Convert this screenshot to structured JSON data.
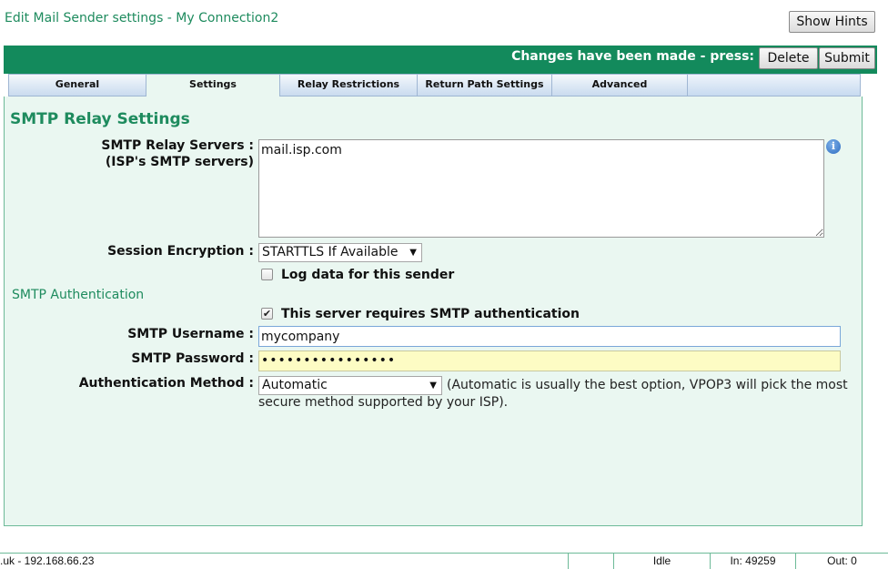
{
  "page": {
    "title": "Edit Mail Sender settings - My Connection2",
    "show_hints_label": "Show Hints"
  },
  "toolbar": {
    "changes_text": "Changes have been made - press:",
    "delete_label": "Delete",
    "submit_label": "Submit"
  },
  "tabs": [
    {
      "label": "General",
      "active": false
    },
    {
      "label": "Settings",
      "active": true
    },
    {
      "label": "Relay Restrictions",
      "active": false
    },
    {
      "label": "Return Path Settings",
      "active": false
    },
    {
      "label": "Advanced",
      "active": false
    }
  ],
  "settings": {
    "section_title": "SMTP Relay Settings",
    "relay_servers_label_1": "SMTP Relay Servers :",
    "relay_servers_label_2": "(ISP's SMTP servers)",
    "relay_servers_value": "mail.isp.com",
    "info_icon_glyph": "i",
    "encryption_label": "Session Encryption :",
    "encryption_value": "STARTTLS If Available",
    "log_data_label": "Log data for this sender",
    "log_data_checked": false,
    "auth_section_title": "SMTP Authentication",
    "requires_auth_label": "This server requires SMTP authentication",
    "requires_auth_checked": true,
    "username_label": "SMTP Username :",
    "username_value": "mycompany",
    "password_label": "SMTP Password :",
    "password_value": "••••••••••••••••",
    "auth_method_label": "Authentication Method :",
    "auth_method_value": "Automatic",
    "auth_method_note": "(Automatic is usually the best option, VPOP3 will pick the most secure method supported by your ISP)."
  },
  "status_bar": {
    "host": ".uk - 192.168.66.23",
    "state": "Idle",
    "in_count": "In: 49259",
    "out_count": "Out: 0"
  },
  "colors": {
    "accent_green": "#138a5c",
    "panel_bg": "#eaf7f1",
    "title_green": "#1e8b5e"
  }
}
